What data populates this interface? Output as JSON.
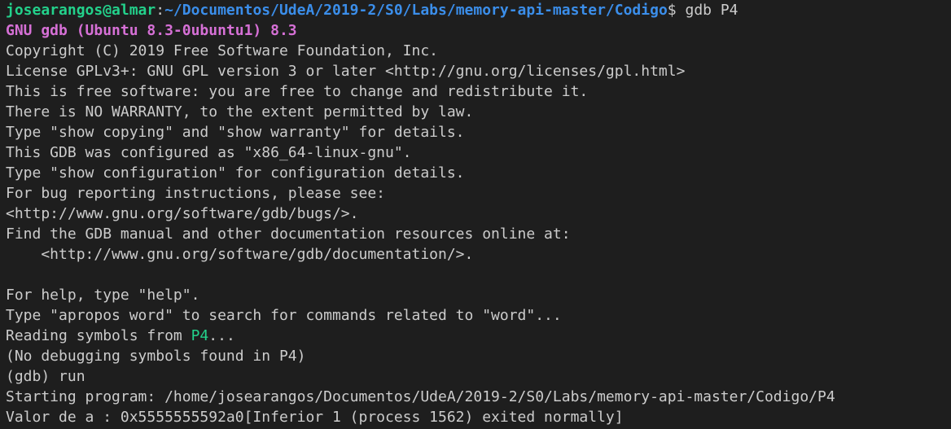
{
  "prompt": {
    "user_host": "josearangos@almar",
    "colon": ":",
    "path": "~/Documentos/UdeA/2019-2/S0/Labs/memory-api-master/Codigo",
    "symbol": "$ ",
    "command": "gdb P4"
  },
  "gdb_title": "GNU gdb (Ubuntu 8.3-0ubuntu1) 8.3",
  "banner": [
    "Copyright (C) 2019 Free Software Foundation, Inc.",
    "License GPLv3+: GNU GPL version 3 or later <http://gnu.org/licenses/gpl.html>",
    "This is free software: you are free to change and redistribute it.",
    "There is NO WARRANTY, to the extent permitted by law.",
    "Type \"show copying\" and \"show warranty\" for details.",
    "This GDB was configured as \"x86_64-linux-gnu\".",
    "Type \"show configuration\" for configuration details.",
    "For bug reporting instructions, please see:",
    "<http://www.gnu.org/software/gdb/bugs/>.",
    "Find the GDB manual and other documentation resources online at:",
    "    <http://www.gnu.org/software/gdb/documentation/>.",
    "",
    "For help, type \"help\".",
    "Type \"apropos word\" to search for commands related to \"word\"..."
  ],
  "reading": {
    "prefix": "Reading symbols from ",
    "file": "P4",
    "suffix": "..."
  },
  "after": [
    "(No debugging symbols found in P4)",
    "(gdb) run",
    "Starting program: /home/josearangos/Documentos/UdeA/2019-2/S0/Labs/memory-api-master/Codigo/P4",
    "Valor de a : 0x5555555592a0[Inferior 1 (process 1562) exited normally]"
  ],
  "colors": {
    "background": "#1e1e1e",
    "foreground": "#cccccc",
    "user_host": "#23d18b",
    "path": "#3b8eea",
    "gdb_title": "#d670d6",
    "file_highlight": "#23d18b"
  }
}
